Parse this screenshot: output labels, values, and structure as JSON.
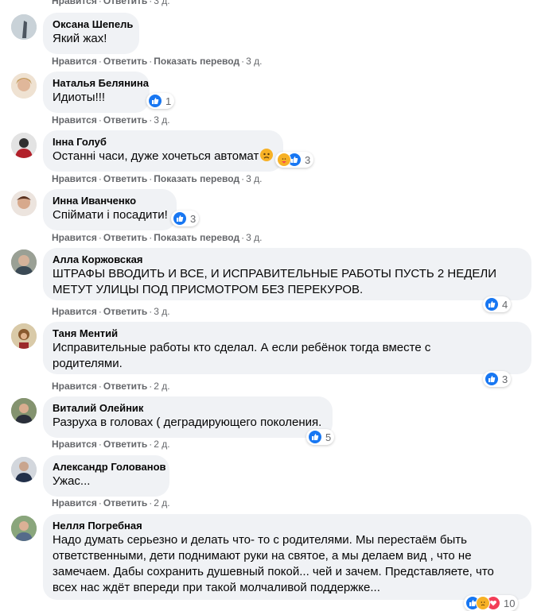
{
  "top_actions": {
    "like": "Нравится",
    "reply": "Ответить",
    "time": "3 д."
  },
  "comments": [
    {
      "author": "Оксана Шепель",
      "lines": [
        "Який жах!"
      ],
      "like": "Нравится",
      "reply": "Ответить",
      "translate": "Показать перевод",
      "time": "3 д."
    },
    {
      "author": "Наталья Белянина",
      "lines": [
        "Идиоты!!!"
      ],
      "reaction_count": "1",
      "like": "Нравится",
      "reply": "Ответить",
      "time": "3 д."
    },
    {
      "author": "Інна Голуб",
      "lines": [
        "Останні часи, дуже хочеться автомат"
      ],
      "reaction_count": "3",
      "like": "Нравится",
      "reply": "Ответить",
      "translate": "Показать перевод",
      "time": "3 д."
    },
    {
      "author": "Инна Иванченко",
      "lines": [
        "Спіймати і посадити!"
      ],
      "reaction_count": "3",
      "like": "Нравится",
      "reply": "Ответить",
      "translate": "Показать перевод",
      "time": "3 д."
    },
    {
      "author": "Алла Коржовская",
      "lines": [
        "ШТРАФЫ ВВОДИТЬ И ВСЕ, И ИСПРАВИТЕЛЬНЫЕ РАБОТЫ ПУСТЬ 2 НЕДЕЛИ",
        "МЕТУТ УЛИЦЫ ПОД ПРИСМОТРОМ БЕЗ ПЕРЕКУРОВ."
      ],
      "reaction_count": "4",
      "like": "Нравится",
      "reply": "Ответить",
      "time": "3 д."
    },
    {
      "author": "Таня Ментий",
      "lines": [
        "Исправительные работы кто сделал. А если ребёнок тогда вместе с",
        "родителями."
      ],
      "reaction_count": "3",
      "like": "Нравится",
      "reply": "Ответить",
      "time": "2 д."
    },
    {
      "author": "Виталий Олейник",
      "lines": [
        "Разруха в головах ( деградирующего поколения."
      ],
      "reaction_count": "5",
      "like": "Нравится",
      "reply": "Ответить",
      "time": "2 д."
    },
    {
      "author": "Александр Голованов",
      "lines": [
        "Ужас..."
      ],
      "like": "Нравится",
      "reply": "Ответить",
      "time": "2 д."
    },
    {
      "author": "Нелля Погребная",
      "lines": [
        "Надо думать серьезно и делать что- то с родителями. Мы перестаём быть",
        "ответственными, дети поднимают руки на святое, а мы делаем вид , что не",
        "замечаем. Дабы сохранить душевный покой... чей и зачем. Представляете, что",
        "всех нас ждёт впереди при такой молчаливой поддержке..."
      ],
      "reaction_count": "10",
      "like": "Нравится",
      "reply": "Ответить",
      "time": "2 д."
    }
  ],
  "colors": {
    "bubble": "#f0f2f5",
    "like_blue": "#1877f2",
    "meta_gray": "#65676b"
  }
}
